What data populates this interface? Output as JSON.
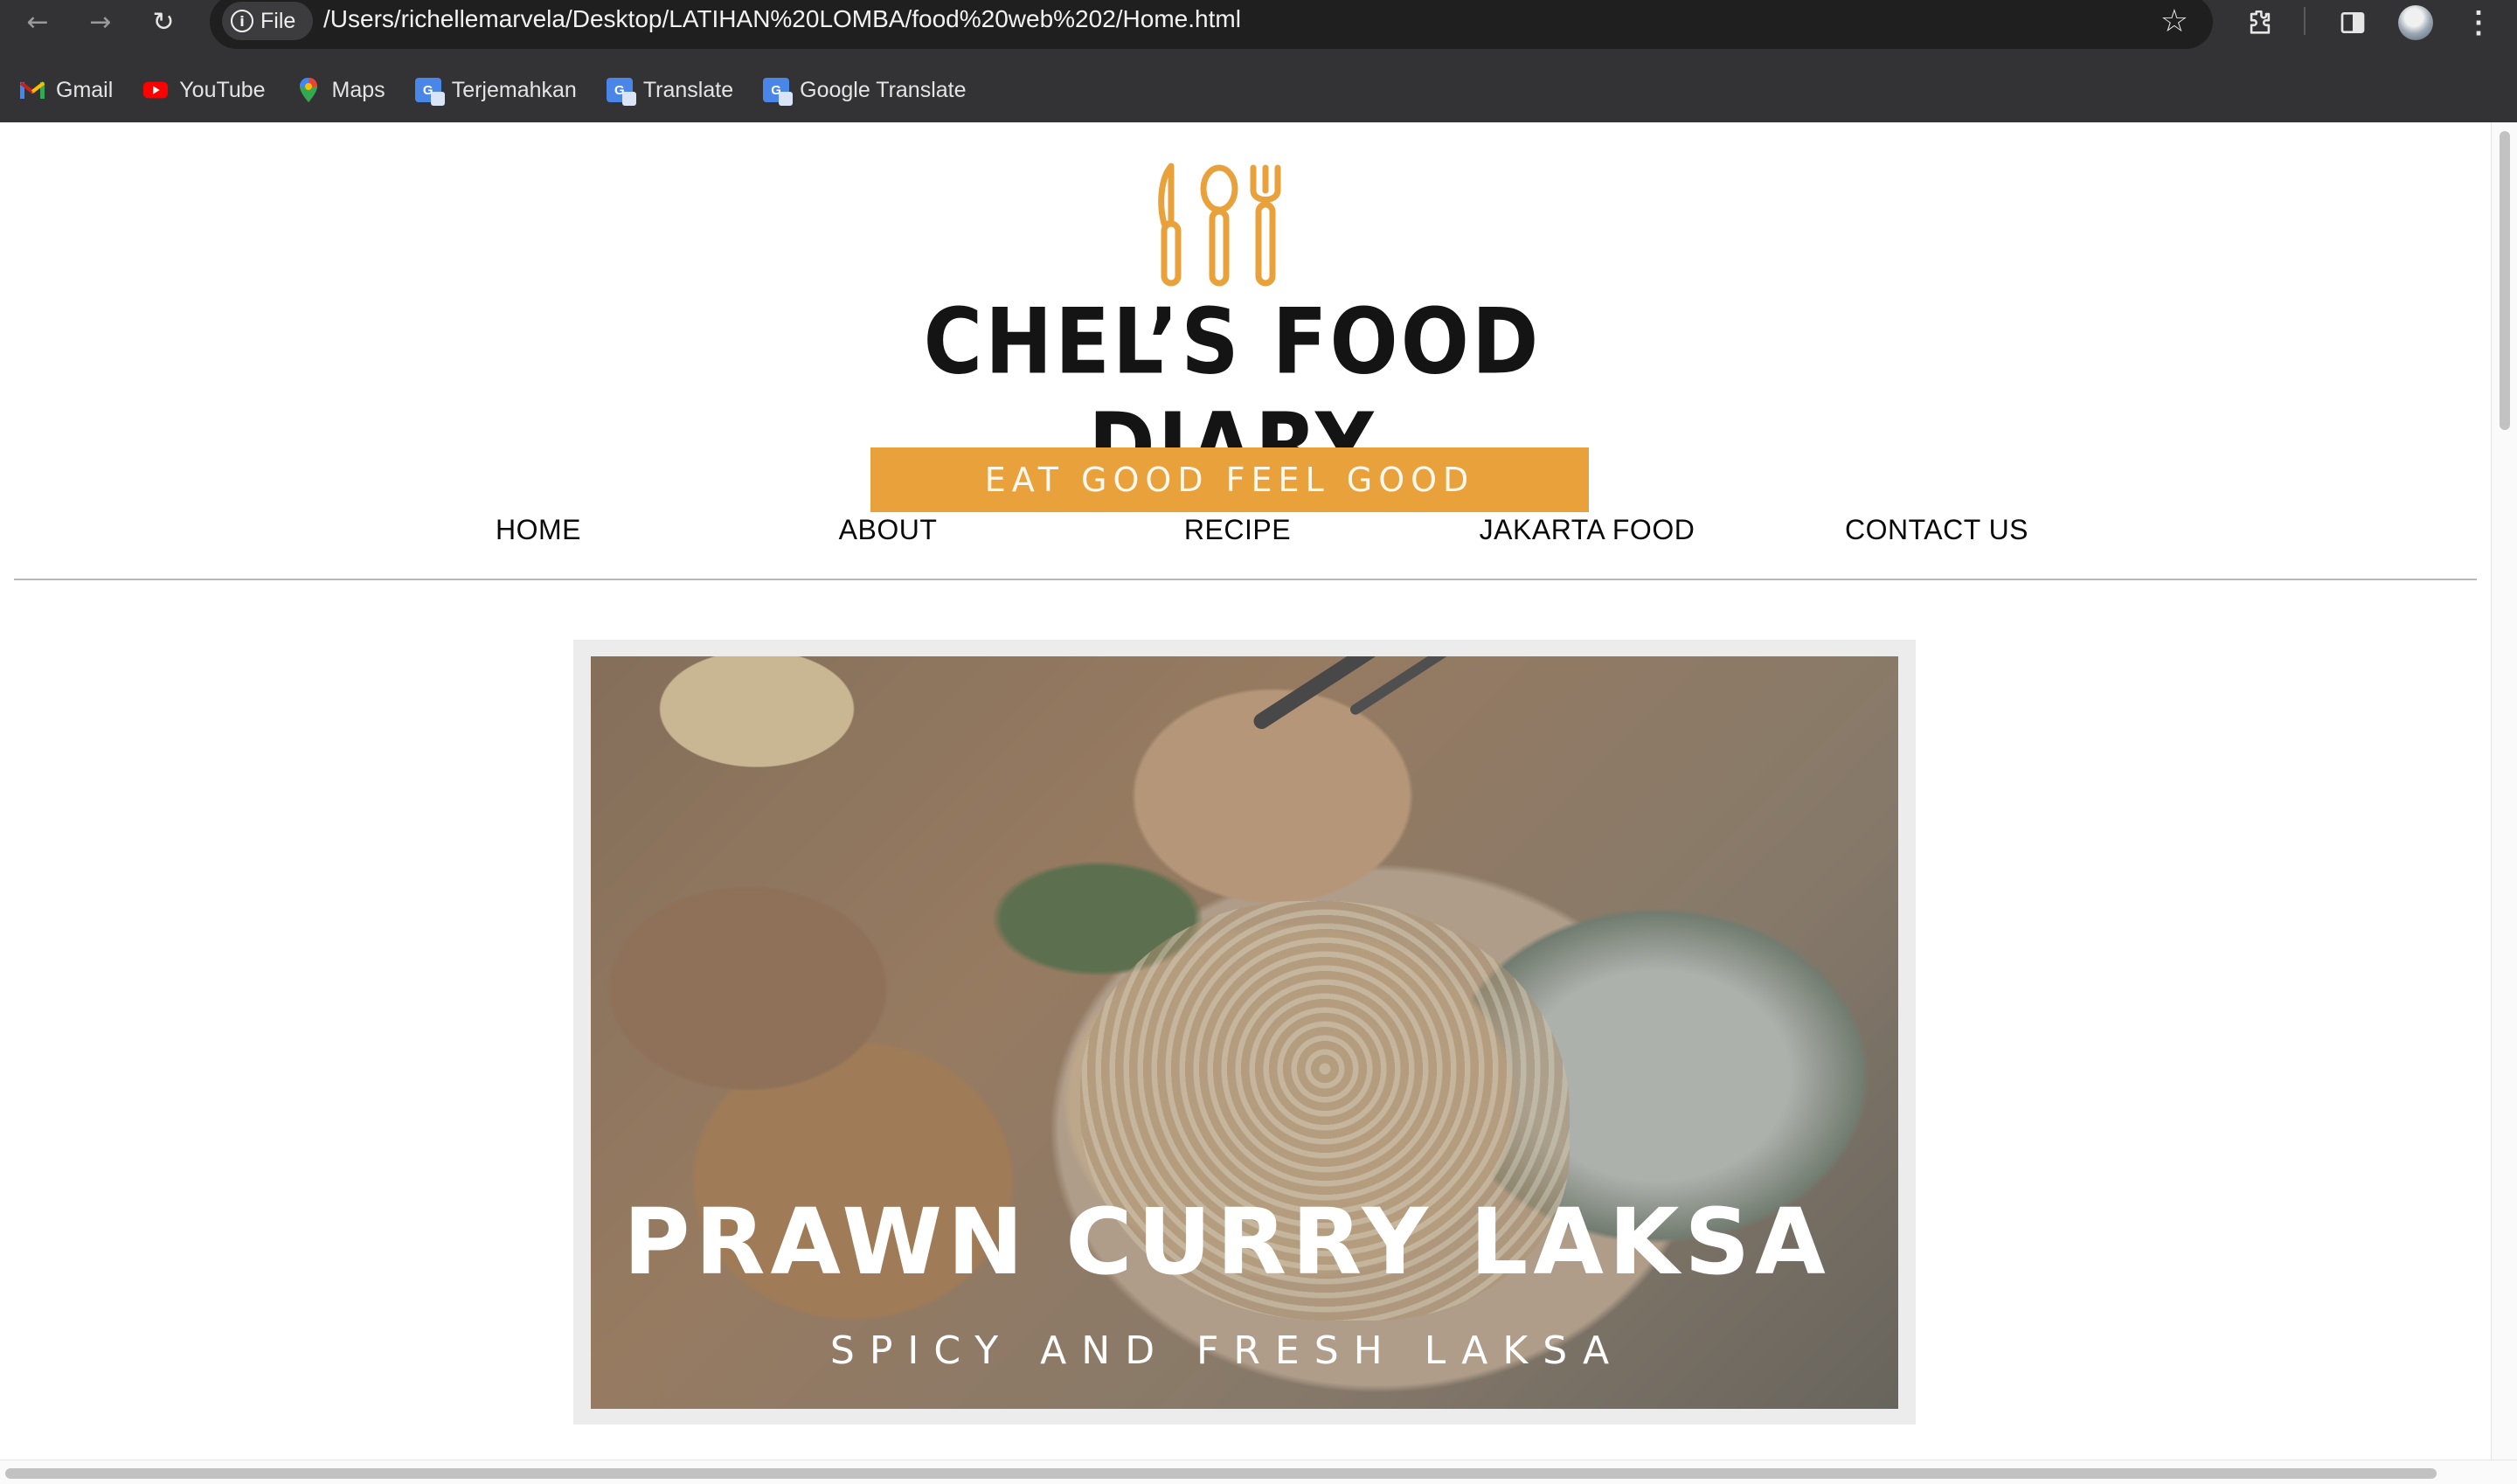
{
  "browser": {
    "file_chip_label": "File",
    "url": "/Users/richellemarvela/Desktop/LATIHAN%20LOMBA/food%20web%202/Home.html",
    "bookmarks": [
      {
        "label": "Gmail",
        "icon": "gmail-icon"
      },
      {
        "label": "YouTube",
        "icon": "youtube-icon"
      },
      {
        "label": "Maps",
        "icon": "maps-icon"
      },
      {
        "label": "Terjemahkan",
        "icon": "google-translate-icon"
      },
      {
        "label": "Translate",
        "icon": "google-translate-icon"
      },
      {
        "label": "Google Translate",
        "icon": "google-translate-icon"
      }
    ]
  },
  "site": {
    "brand": "CHEL’S FOOD DIARY",
    "tagline": "EAT GOOD FEEL GOOD",
    "accent_color": "#e9a23b",
    "nav": [
      "HOME",
      "ABOUT",
      "RECIPE",
      "JAKARTA FOOD",
      "CONTACT US"
    ]
  },
  "hero": {
    "title": "PRAWN CURRY LAKSA",
    "subtitle": "SPICY AND FRESH LAKSA"
  }
}
